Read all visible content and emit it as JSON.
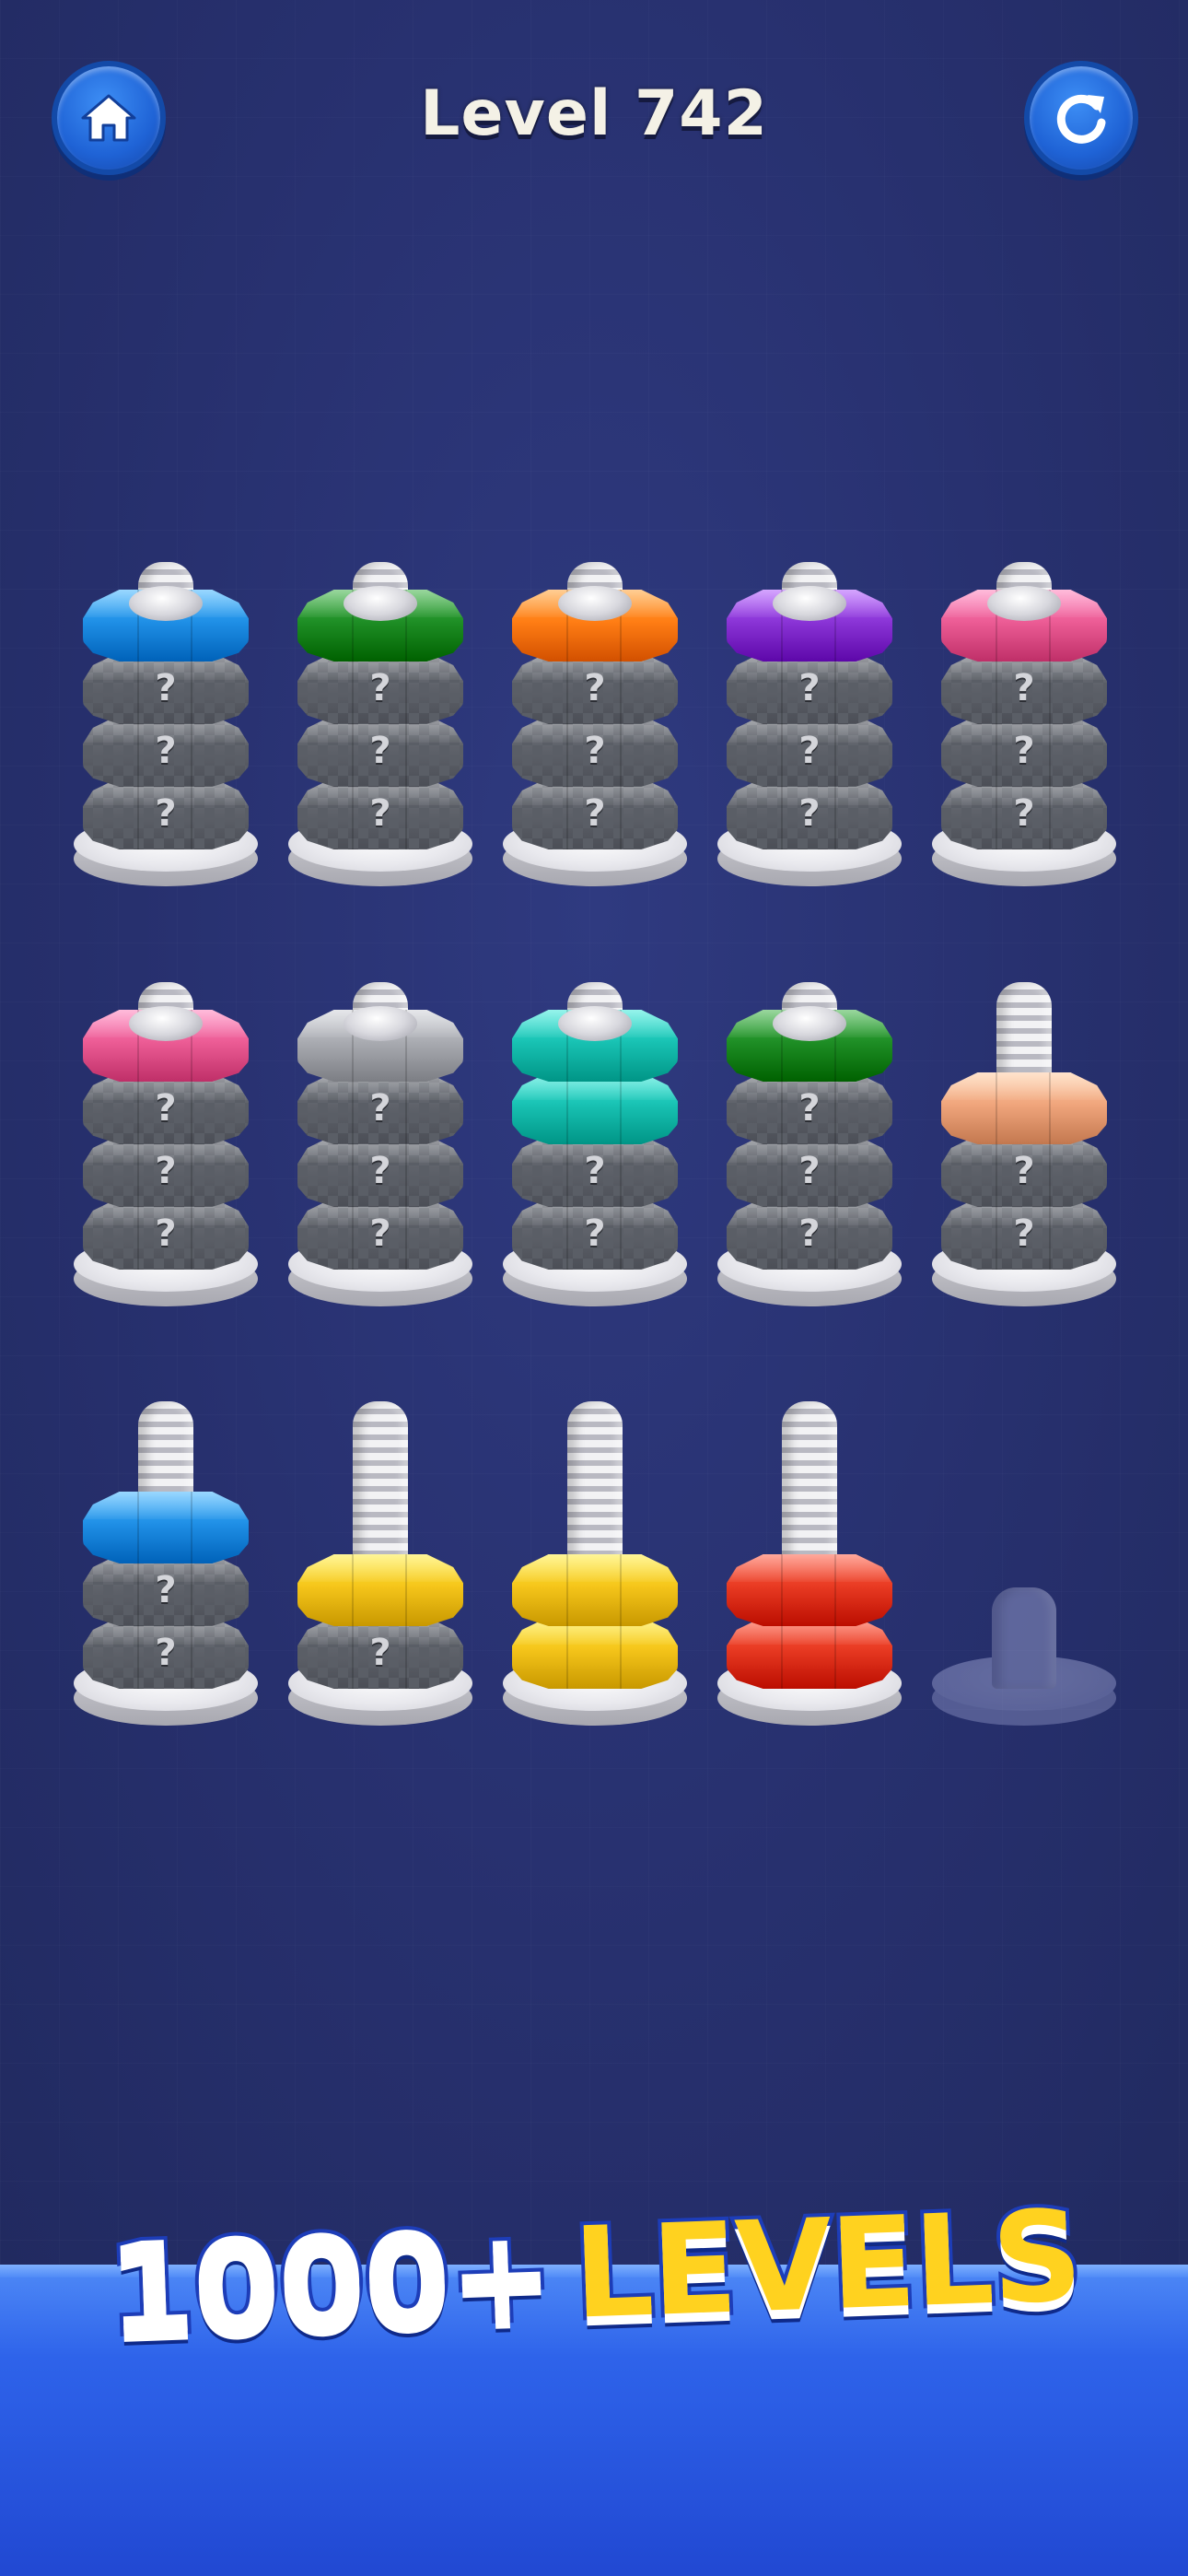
{
  "header": {
    "home_icon": "home-icon",
    "restart_icon": "restart-icon",
    "level_label": "Level 742"
  },
  "colors": {
    "blue": "#1f8fe6",
    "green": "#1e8e25",
    "orange": "#ff7d14",
    "purple": "#8a34d6",
    "pink": "#ec5c95",
    "silver": "#a9abb1",
    "teal": "#18c2b3",
    "peach": "#f0a57c",
    "yellow": "#f5c51a",
    "red": "#e83a22",
    "hidden": "#5a5e66"
  },
  "board": {
    "rows": [
      [
        {
          "nuts": [
            "hidden",
            "hidden",
            "hidden",
            "blue"
          ]
        },
        {
          "nuts": [
            "hidden",
            "hidden",
            "hidden",
            "green"
          ]
        },
        {
          "nuts": [
            "hidden",
            "hidden",
            "hidden",
            "orange"
          ]
        },
        {
          "nuts": [
            "hidden",
            "hidden",
            "hidden",
            "purple"
          ]
        },
        {
          "nuts": [
            "hidden",
            "hidden",
            "hidden",
            "pink"
          ]
        }
      ],
      [
        {
          "nuts": [
            "hidden",
            "hidden",
            "hidden",
            "pink"
          ]
        },
        {
          "nuts": [
            "hidden",
            "hidden",
            "hidden",
            "silver"
          ]
        },
        {
          "nuts": [
            "hidden",
            "hidden",
            "teal",
            "teal"
          ]
        },
        {
          "nuts": [
            "hidden",
            "hidden",
            "hidden",
            "green"
          ]
        },
        {
          "nuts": [
            "hidden",
            "hidden",
            "peach"
          ]
        }
      ],
      [
        {
          "nuts": [
            "hidden",
            "hidden",
            "blue"
          ]
        },
        {
          "nuts": [
            "hidden",
            "yellow"
          ]
        },
        {
          "nuts": [
            "yellow",
            "yellow"
          ]
        },
        {
          "nuts": [
            "red",
            "red"
          ]
        },
        {
          "nuts": [],
          "ghost": true
        }
      ]
    ],
    "hidden_mark": "?"
  },
  "banner": {
    "number": "1000+",
    "word": "LEVELS"
  }
}
